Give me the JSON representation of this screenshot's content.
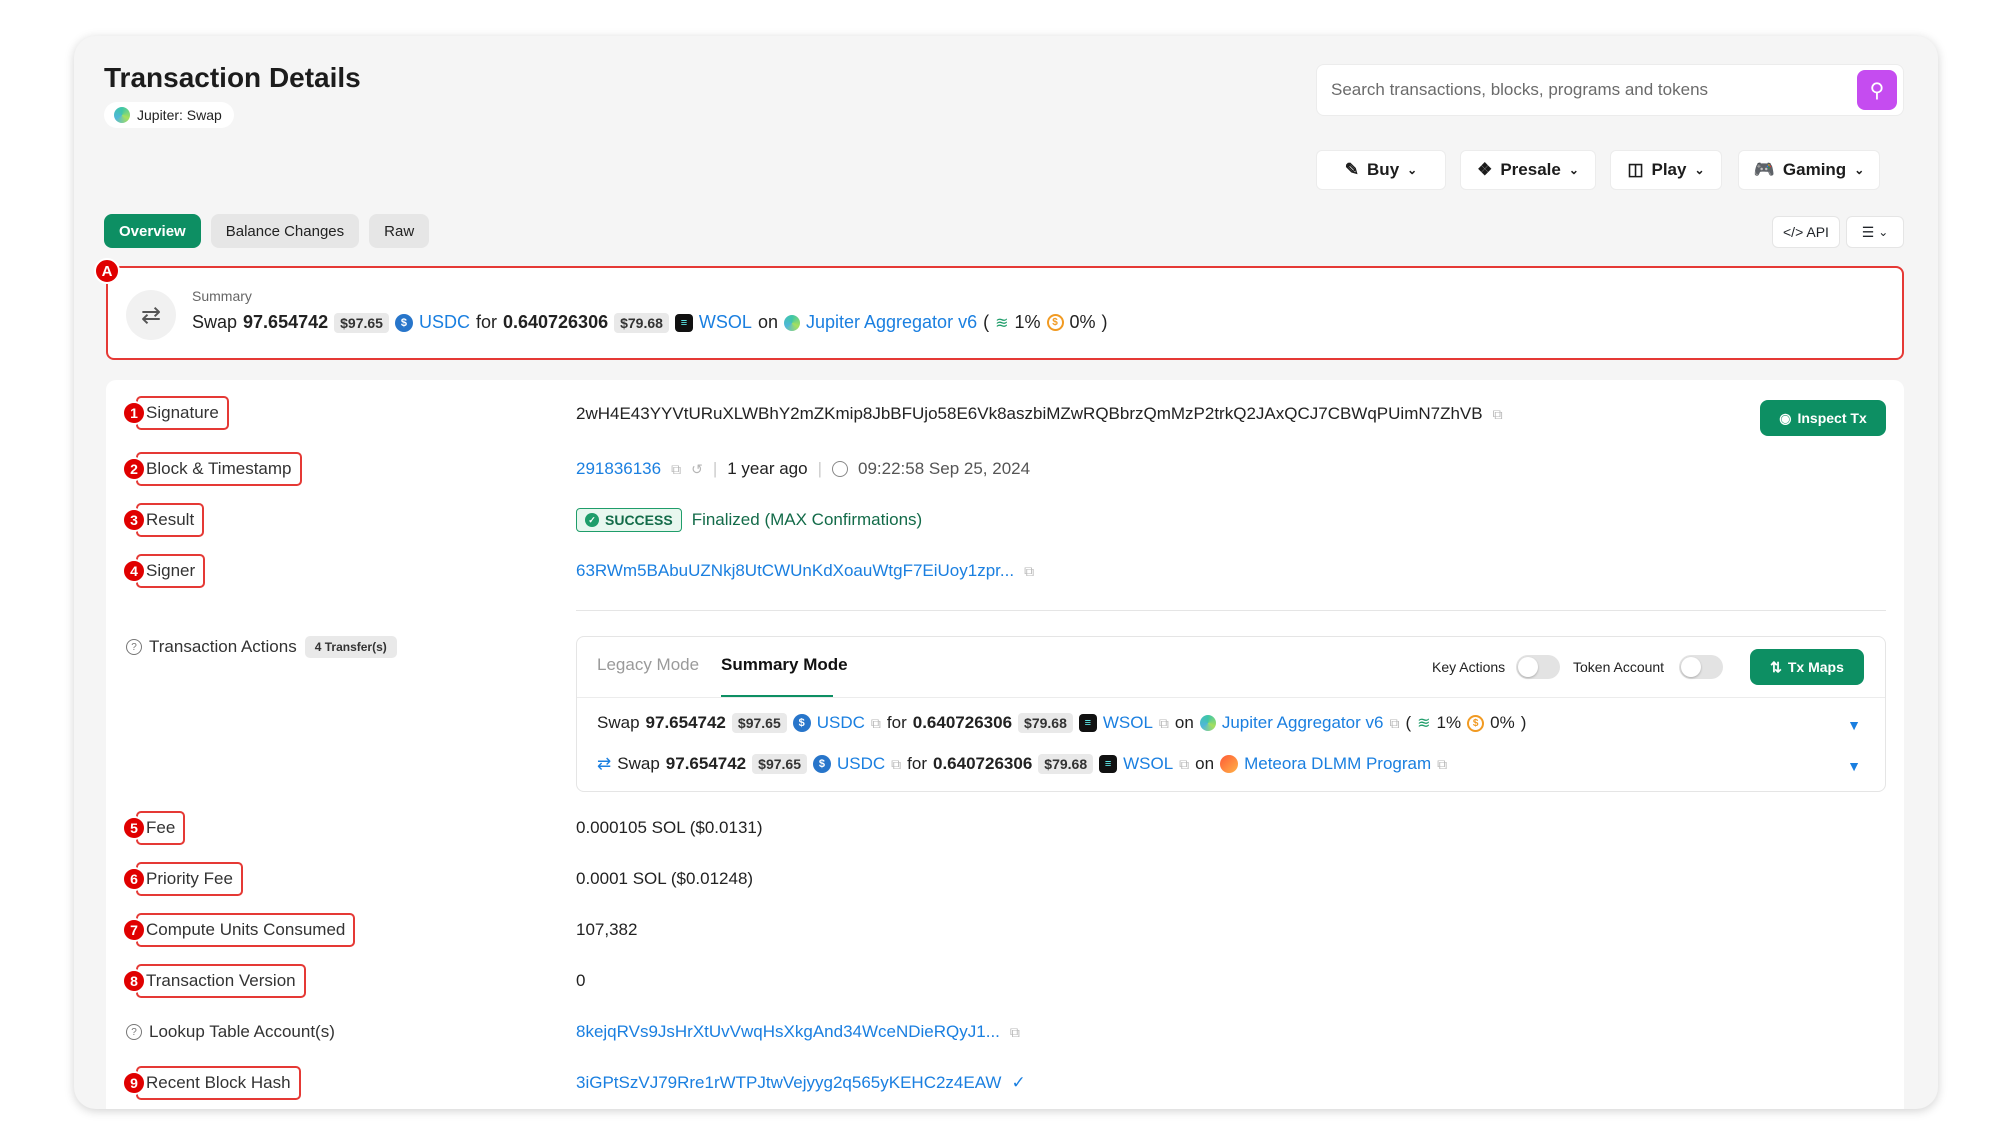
{
  "header": {
    "title": "Transaction Details",
    "program_label": "Jupiter: Swap",
    "search_placeholder": "Search transactions, blocks, programs and tokens"
  },
  "nav_menus": [
    {
      "label": "Buy",
      "icon": "tag-icon"
    },
    {
      "label": "Presale",
      "icon": "presale-icon"
    },
    {
      "label": "Play",
      "icon": "monitor-icon"
    },
    {
      "label": "Gaming",
      "icon": "gamepad-icon"
    }
  ],
  "tabs": [
    "Overview",
    "Balance Changes",
    "Raw"
  ],
  "active_tab": "Overview",
  "toolbar": {
    "api_label": "</> API"
  },
  "annotation_badges": {
    "summary": "A",
    "rows": [
      "1",
      "2",
      "3",
      "4",
      "5",
      "6",
      "7",
      "8",
      "9"
    ]
  },
  "summary": {
    "label": "Summary",
    "swap_word": "Swap",
    "amount_in": "97.654742",
    "amount_in_usd": "$97.65",
    "token_in": "USDC",
    "for_word": "for",
    "amount_out": "0.640726306",
    "amount_out_usd": "$79.68",
    "token_out": "WSOL",
    "on_word": "on",
    "platform": "Jupiter Aggregator v6",
    "open_paren": "(",
    "fee_pct": "1%",
    "slippage_pct": "0%",
    "close_paren": ")"
  },
  "details": {
    "signature_label": "Signature",
    "signature_value": "2wH4E43YYVtURuXLWBhY2mZKmip8JbBFUjo58E6Vk8aszbiMZwRQBbrzQmMzP2trkQ2JAxQCJ7CBWqPUimN7ZhVB",
    "inspect_label": "Inspect Tx",
    "block_label": "Block & Timestamp",
    "block_value": "291836136",
    "block_age": "1 year ago",
    "block_time": "09:22:58 Sep 25, 2024",
    "result_label": "Result",
    "result_status": "SUCCESS",
    "result_text": "Finalized (MAX Confirmations)",
    "signer_label": "Signer",
    "signer_value": "63RWm5BAbuUZNkj8UtCWUnKdXoauWtgF7EiUoy1zpr...",
    "actions_label": "Transaction Actions",
    "actions_count": "4 Transfer(s)",
    "fee_label": "Fee",
    "fee_value": "0.000105 SOL ($0.0131)",
    "priority_fee_label": "Priority Fee",
    "priority_fee_value": "0.0001 SOL ($0.01248)",
    "compute_label": "Compute Units Consumed",
    "compute_value": "107,382",
    "version_label": "Transaction Version",
    "version_value": "0",
    "lookup_label": "Lookup Table Account(s)",
    "lookup_value": "8kejqRVs9JsHrXtUvVwqHsXkgAnd34WceNDieRQyJ1...",
    "recent_hash_label": "Recent Block Hash",
    "recent_hash_value": "3iGPtSzVJ79Rre1rWTPJtwVejyyg2q565yKEHC2z4EAW"
  },
  "actions_panel": {
    "legacy_mode": "Legacy Mode",
    "summary_mode": "Summary Mode",
    "key_actions_label": "Key Actions",
    "token_account_label": "Token Account",
    "tx_maps_label": "Tx Maps",
    "line1": {
      "swap_word": "Swap",
      "amount_in": "97.654742",
      "amount_in_usd": "$97.65",
      "token_in": "USDC",
      "for_word": "for",
      "amount_out": "0.640726306",
      "amount_out_usd": "$79.68",
      "token_out": "WSOL",
      "on_word": "on",
      "platform": "Jupiter Aggregator v6",
      "open_paren": "(",
      "fee_pct": "1%",
      "slippage_pct": "0%",
      "close_paren": ")"
    },
    "line2": {
      "swap_word": "Swap",
      "amount_in": "97.654742",
      "amount_in_usd": "$97.65",
      "token_in": "USDC",
      "for_word": "for",
      "amount_out": "0.640726306",
      "amount_out_usd": "$79.68",
      "token_out": "WSOL",
      "on_word": "on",
      "platform": "Meteora DLMM Program"
    }
  },
  "colors": {
    "accent_green": "#0d8f63",
    "link_blue": "#1a7fe0",
    "annotation_red": "#e53935",
    "search_button": "#c54cf0"
  }
}
